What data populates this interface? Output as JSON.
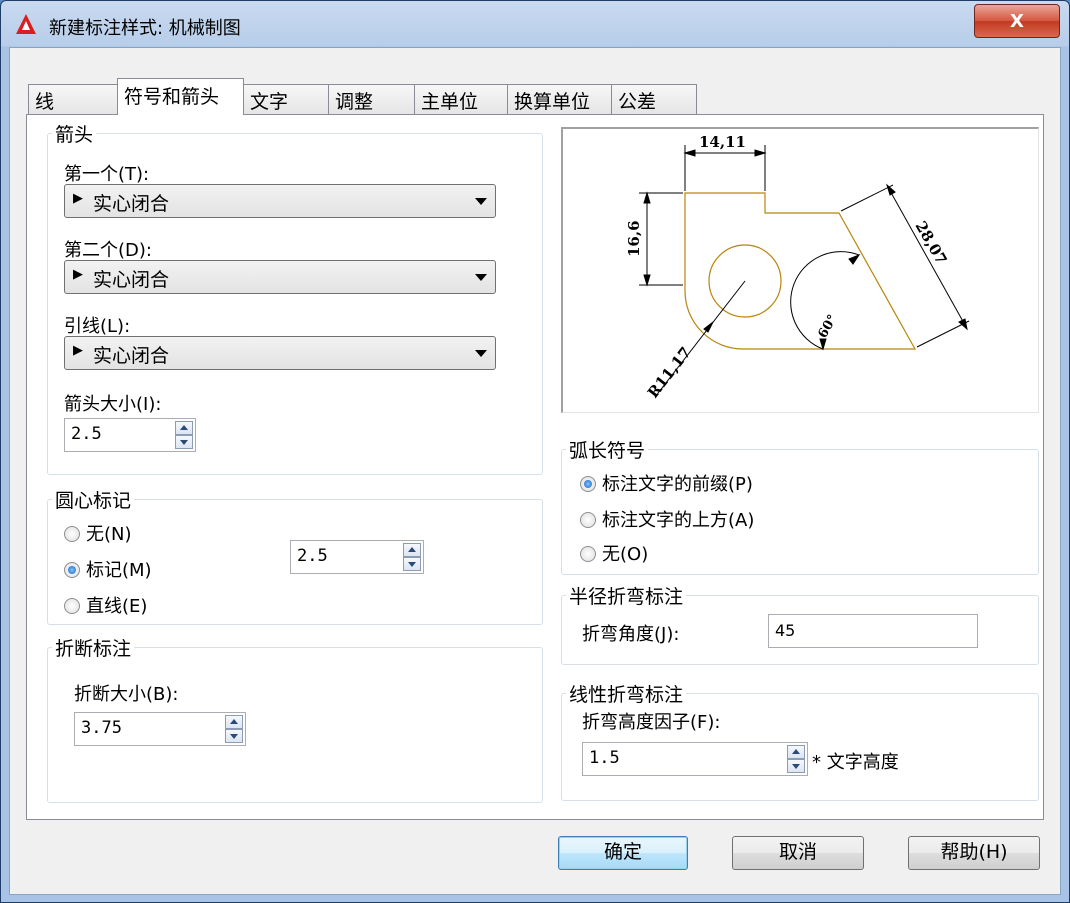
{
  "window": {
    "title": "新建标注样式: 机械制图",
    "close_glyph": "X"
  },
  "tabs": [
    {
      "label": "线"
    },
    {
      "label": "符号和箭头"
    },
    {
      "label": "文字"
    },
    {
      "label": "调整"
    },
    {
      "label": "主单位"
    },
    {
      "label": "换算单位"
    },
    {
      "label": "公差"
    }
  ],
  "active_tab": "符号和箭头",
  "arrows": {
    "title": "箭头",
    "first_label": "第一个(T):",
    "first_value": "实心闭合",
    "second_label": "第二个(D):",
    "second_value": "实心闭合",
    "leader_label": "引线(L):",
    "leader_value": "实心闭合",
    "size_label": "箭头大小(I):",
    "size_value": "2.5"
  },
  "center_marks": {
    "title": "圆心标记",
    "options": [
      {
        "label": "无(N)",
        "selected": false
      },
      {
        "label": "标记(M)",
        "selected": true
      },
      {
        "label": "直线(E)",
        "selected": false
      }
    ],
    "size_value": "2.5"
  },
  "dim_break": {
    "title": "折断标注",
    "size_label": "折断大小(B):",
    "size_value": "3.75"
  },
  "preview": {
    "dim_top": "14,11",
    "dim_left": "16,6",
    "dim_diag": "28,07",
    "dim_angle": "60°",
    "dim_radius": "R11,17",
    "line_color": "#b8860b"
  },
  "arc_length": {
    "title": "弧长符号",
    "options": [
      {
        "label": "标注文字的前缀(P)",
        "selected": true
      },
      {
        "label": "标注文字的上方(A)",
        "selected": false
      },
      {
        "label": "无(O)",
        "selected": false
      }
    ]
  },
  "radius_jog": {
    "title": "半径折弯标注",
    "angle_label": "折弯角度(J):",
    "angle_value": "45"
  },
  "linear_jog": {
    "title": "线性折弯标注",
    "factor_label": "折弯高度因子(F):",
    "factor_value": "1.5",
    "suffix": "* 文字高度"
  },
  "buttons": {
    "ok": "确定",
    "cancel": "取消",
    "help": "帮助(H)"
  }
}
